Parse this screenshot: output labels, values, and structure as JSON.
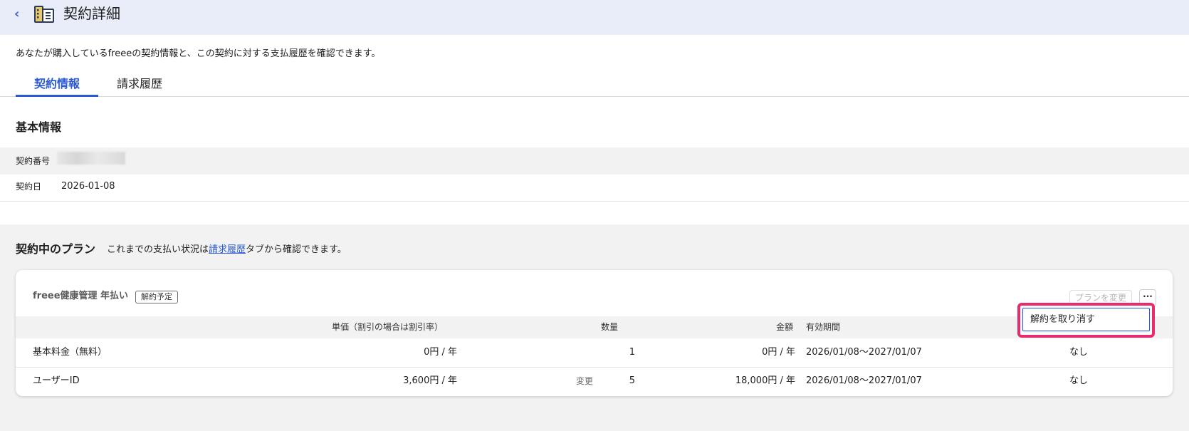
{
  "header": {
    "title": "契約詳細",
    "back_icon": "chevron-left-icon",
    "page_icon": "building-document-icon"
  },
  "description": "あなたが購入しているfreeeの契約情報と、この契約に対する支払履歴を確認できます。",
  "tabs": [
    {
      "label": "契約情報",
      "active": true
    },
    {
      "label": "請求履歴",
      "active": false
    }
  ],
  "basic_info": {
    "title": "基本情報",
    "contract_number_label": "契約番号",
    "contract_date_label": "契約日",
    "contract_date": "2026-01-08"
  },
  "plans": {
    "title": "契約中のプラン",
    "desc_prefix": "これまでの支払い状況は",
    "desc_link": "請求履歴",
    "desc_suffix": "タブから確認できます。",
    "plan": {
      "name": "freee健康管理 年払い",
      "badge": "解約予定",
      "change_button": "プランを変更",
      "more_button": "···",
      "columns": {
        "unit_price": "単価（割引の場合は割引率）",
        "quantity": "数量",
        "amount": "金額",
        "period": "有効期間"
      },
      "rows": [
        {
          "item": "基本料金（無料）",
          "unit_price": "0円 / 年",
          "change": "",
          "quantity": "1",
          "amount": "0円 / 年",
          "period": "2026/01/08～2027/01/07",
          "other": "なし"
        },
        {
          "item": "ユーザーID",
          "unit_price": "3,600円 / 年",
          "change": "変更",
          "quantity": "5",
          "amount": "18,000円 / 年",
          "period": "2026/01/08～2027/01/07",
          "other": "なし"
        }
      ]
    },
    "dropdown_item": "解約を取り消す"
  },
  "colors": {
    "accent": "#2b59d6",
    "header_bg": "#e9edfa",
    "highlight": "#e82a6e"
  }
}
